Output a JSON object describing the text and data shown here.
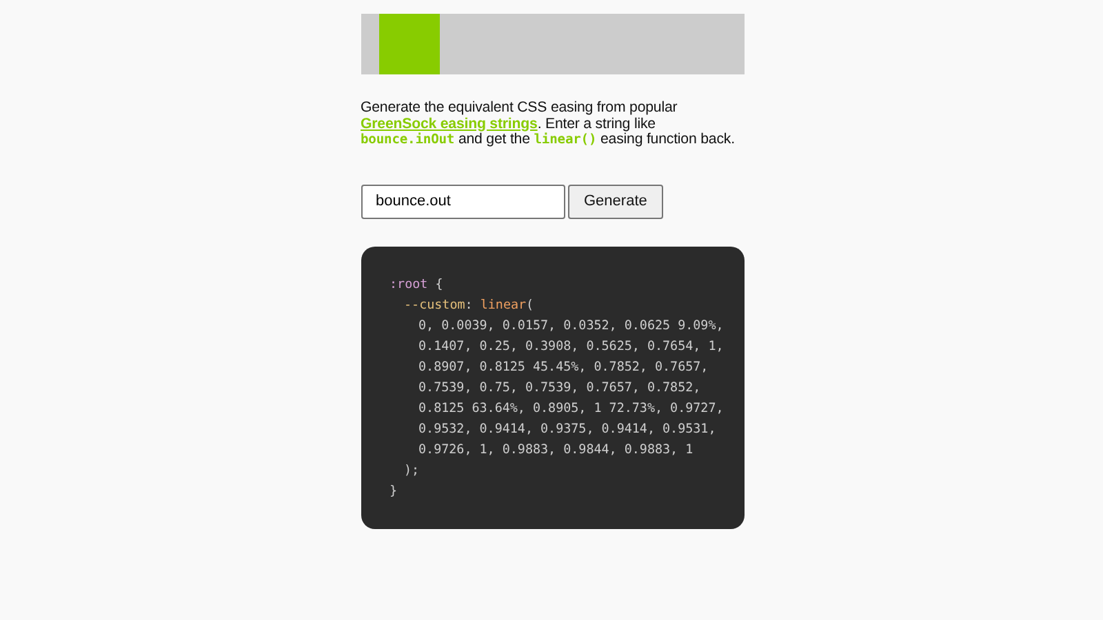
{
  "intro": [
    {
      "kind": "text",
      "text": "Generate the equivalent CSS easing from popular "
    },
    {
      "kind": "link",
      "text": "GreenSock easing strings"
    },
    {
      "kind": "text",
      "text": ". Enter a string like "
    },
    {
      "kind": "code",
      "text": "bounce.inOut"
    },
    {
      "kind": "text",
      "text": " and get the "
    },
    {
      "kind": "code",
      "text": "linear()"
    },
    {
      "kind": "text",
      "text": " easing function back."
    }
  ],
  "input": {
    "value": "bounce.out"
  },
  "button": {
    "label": "Generate"
  },
  "code_lines": [
    {
      "kind": "rule",
      "tokens": [
        {
          "kind": "selector",
          "text": ":root"
        },
        {
          "kind": "plain",
          "text": " {"
        }
      ]
    },
    {
      "kind": "declaration",
      "tokens": [
        {
          "kind": "property",
          "text": "--custom"
        },
        {
          "kind": "plain",
          "text": ": "
        },
        {
          "kind": "function",
          "text": "linear"
        },
        {
          "kind": "plain",
          "text": "("
        }
      ]
    },
    {
      "kind": "value",
      "tokens": [
        {
          "kind": "plain",
          "text": "0, 0.0039, 0.0157, 0.0352, 0.0625 9.09%,"
        }
      ]
    },
    {
      "kind": "value",
      "tokens": [
        {
          "kind": "plain",
          "text": "0.1407, 0.25, 0.3908, 0.5625, 0.7654, 1,"
        }
      ]
    },
    {
      "kind": "value",
      "tokens": [
        {
          "kind": "plain",
          "text": "0.8907, 0.8125 45.45%, 0.7852, 0.7657,"
        }
      ]
    },
    {
      "kind": "value",
      "tokens": [
        {
          "kind": "plain",
          "text": "0.7539, 0.75, 0.7539, 0.7657, 0.7852,"
        }
      ]
    },
    {
      "kind": "value",
      "tokens": [
        {
          "kind": "plain",
          "text": "0.8125 63.64%, 0.8905, 1 72.73%, 0.9727,"
        }
      ]
    },
    {
      "kind": "value",
      "tokens": [
        {
          "kind": "plain",
          "text": "0.9532, 0.9414, 0.9375, 0.9414, 0.9531,"
        }
      ]
    },
    {
      "kind": "value",
      "tokens": [
        {
          "kind": "plain",
          "text": "0.9726, 1, 0.9883, 0.9844, 0.9883, 1"
        }
      ]
    },
    {
      "kind": "declaration",
      "tokens": [
        {
          "kind": "plain",
          "text": ");"
        }
      ]
    },
    {
      "kind": "rule",
      "tokens": [
        {
          "kind": "plain",
          "text": "}"
        }
      ]
    }
  ]
}
